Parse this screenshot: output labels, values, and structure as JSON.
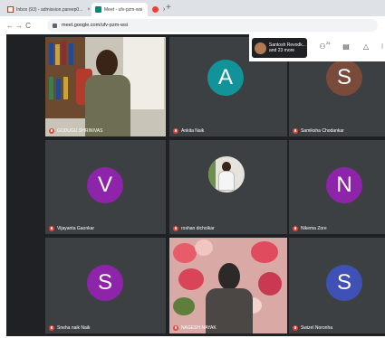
{
  "browser": {
    "tabs": [
      {
        "label": "Inbox (93) - admission.pareep0...",
        "icon": "gmail-icon"
      },
      {
        "label": "Meet - ufv-pzm-wsi",
        "icon": "meet-icon"
      },
      {
        "label": "x",
        "icon": "red-dot-icon"
      }
    ],
    "new_tab": "+",
    "nav": {
      "back": "←",
      "forward": "→",
      "reload": "C"
    },
    "url": "meet.google.com/ufv-pzm-wsi"
  },
  "meet": {
    "presenter_chip": {
      "line1": "Santosh Revodk...",
      "line2": "and 23 more"
    },
    "participant_count": "24",
    "participants": [
      {
        "name": "GODUGU SHRINIVAS",
        "kind": "video"
      },
      {
        "name": "Ankita Naik",
        "initial": "A",
        "color": "#12939a"
      },
      {
        "name": "Samiksha Chodankar",
        "initial": "S",
        "color": "#7a4a3a"
      },
      {
        "name": "Vijayanta Gaonkar",
        "initial": "V",
        "color": "#8e24aa"
      },
      {
        "name": "roshan dicholkar",
        "kind": "photo"
      },
      {
        "name": "Nikema Zore",
        "initial": "N",
        "color": "#8e24aa"
      },
      {
        "name": "Sneha naik Naik",
        "initial": "S",
        "color": "#8e24aa"
      },
      {
        "name": "NAGESH NAYAK",
        "kind": "video"
      },
      {
        "name": "Swizel Noronha",
        "initial": "S",
        "color": "#3f51b5"
      }
    ]
  }
}
